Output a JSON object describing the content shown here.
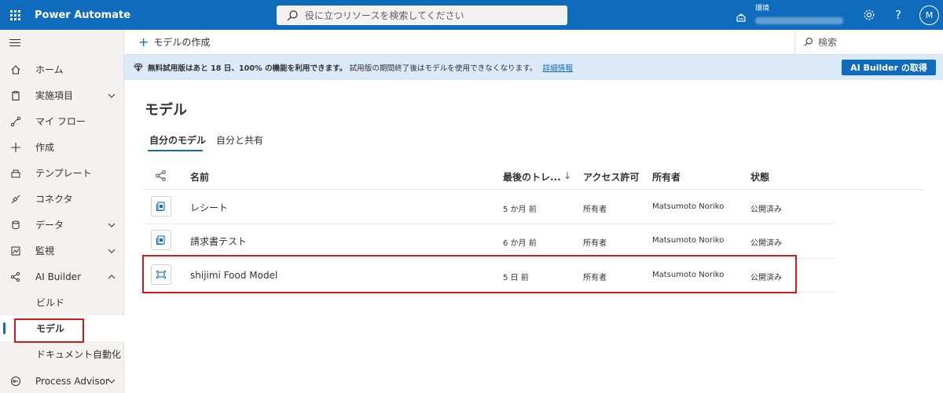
{
  "topbar": {
    "app_name": "Power Automate",
    "search_placeholder": "役に立つリソースを検索してください",
    "env_label": "環境",
    "avatar_initial": "M",
    "icons": [
      "waffle-icon",
      "search-icon",
      "environment-icon",
      "settings-icon",
      "help-icon"
    ]
  },
  "sidebar": {
    "items": [
      {
        "label": "ホーム",
        "icon": "home-icon"
      },
      {
        "label": "実施項目",
        "icon": "clipboard-icon",
        "chevron": "down"
      },
      {
        "label": "マイ フロー",
        "icon": "flow-icon"
      },
      {
        "label": "作成",
        "icon": "plus-icon"
      },
      {
        "label": "テンプレート",
        "icon": "template-icon"
      },
      {
        "label": "コネクタ",
        "icon": "connector-icon"
      },
      {
        "label": "データ",
        "icon": "database-icon",
        "chevron": "down"
      },
      {
        "label": "監視",
        "icon": "monitor-icon",
        "chevron": "down"
      },
      {
        "label": "AI Builder",
        "icon": "ai-builder-icon",
        "chevron": "up"
      },
      {
        "label": "ビルド"
      },
      {
        "label": "モデル",
        "active": true
      },
      {
        "label": "ドキュメント自動化"
      },
      {
        "label": "Process Advisor",
        "icon": "process-advisor-icon",
        "chevron": "down"
      }
    ]
  },
  "commandbar": {
    "create_label": "モデルの作成",
    "search_label": "検索"
  },
  "banner": {
    "bold_text": "無料試用版はあと 18 日、100% の機能を利用できます。",
    "text": "試用版の期間終了後はモデルを使用できなくなります。",
    "link": "詳細情報",
    "button": "AI Builder の取得"
  },
  "main": {
    "title": "モデル",
    "tabs": [
      {
        "label": "自分のモデル",
        "selected": true
      },
      {
        "label": "自分と共有",
        "selected": false
      }
    ],
    "columns": [
      "名前",
      "最後のトレ...",
      "↓",
      "アクセス許可",
      "所有者",
      "状態"
    ],
    "rows": [
      {
        "name": "レシート",
        "last_trained": "5 か月 前",
        "permission": "所有者",
        "owner": "Matsumoto Noriko",
        "status": "公開済み",
        "icon": "document-model-icon"
      },
      {
        "name": "請求書テスト",
        "last_trained": "6 か月 前",
        "permission": "所有者",
        "owner": "Matsumoto Noriko",
        "status": "公開済み",
        "icon": "document-model-icon"
      },
      {
        "name": "shijimi Food Model",
        "last_trained": "5 日 前",
        "permission": "所有者",
        "owner": "Matsumoto Noriko",
        "status": "公開済み",
        "icon": "object-detection-icon"
      }
    ]
  },
  "colors": {
    "brand": "#0f6cbd",
    "banner_bg": "#dbe9f9",
    "highlight": "#d11a1a"
  }
}
